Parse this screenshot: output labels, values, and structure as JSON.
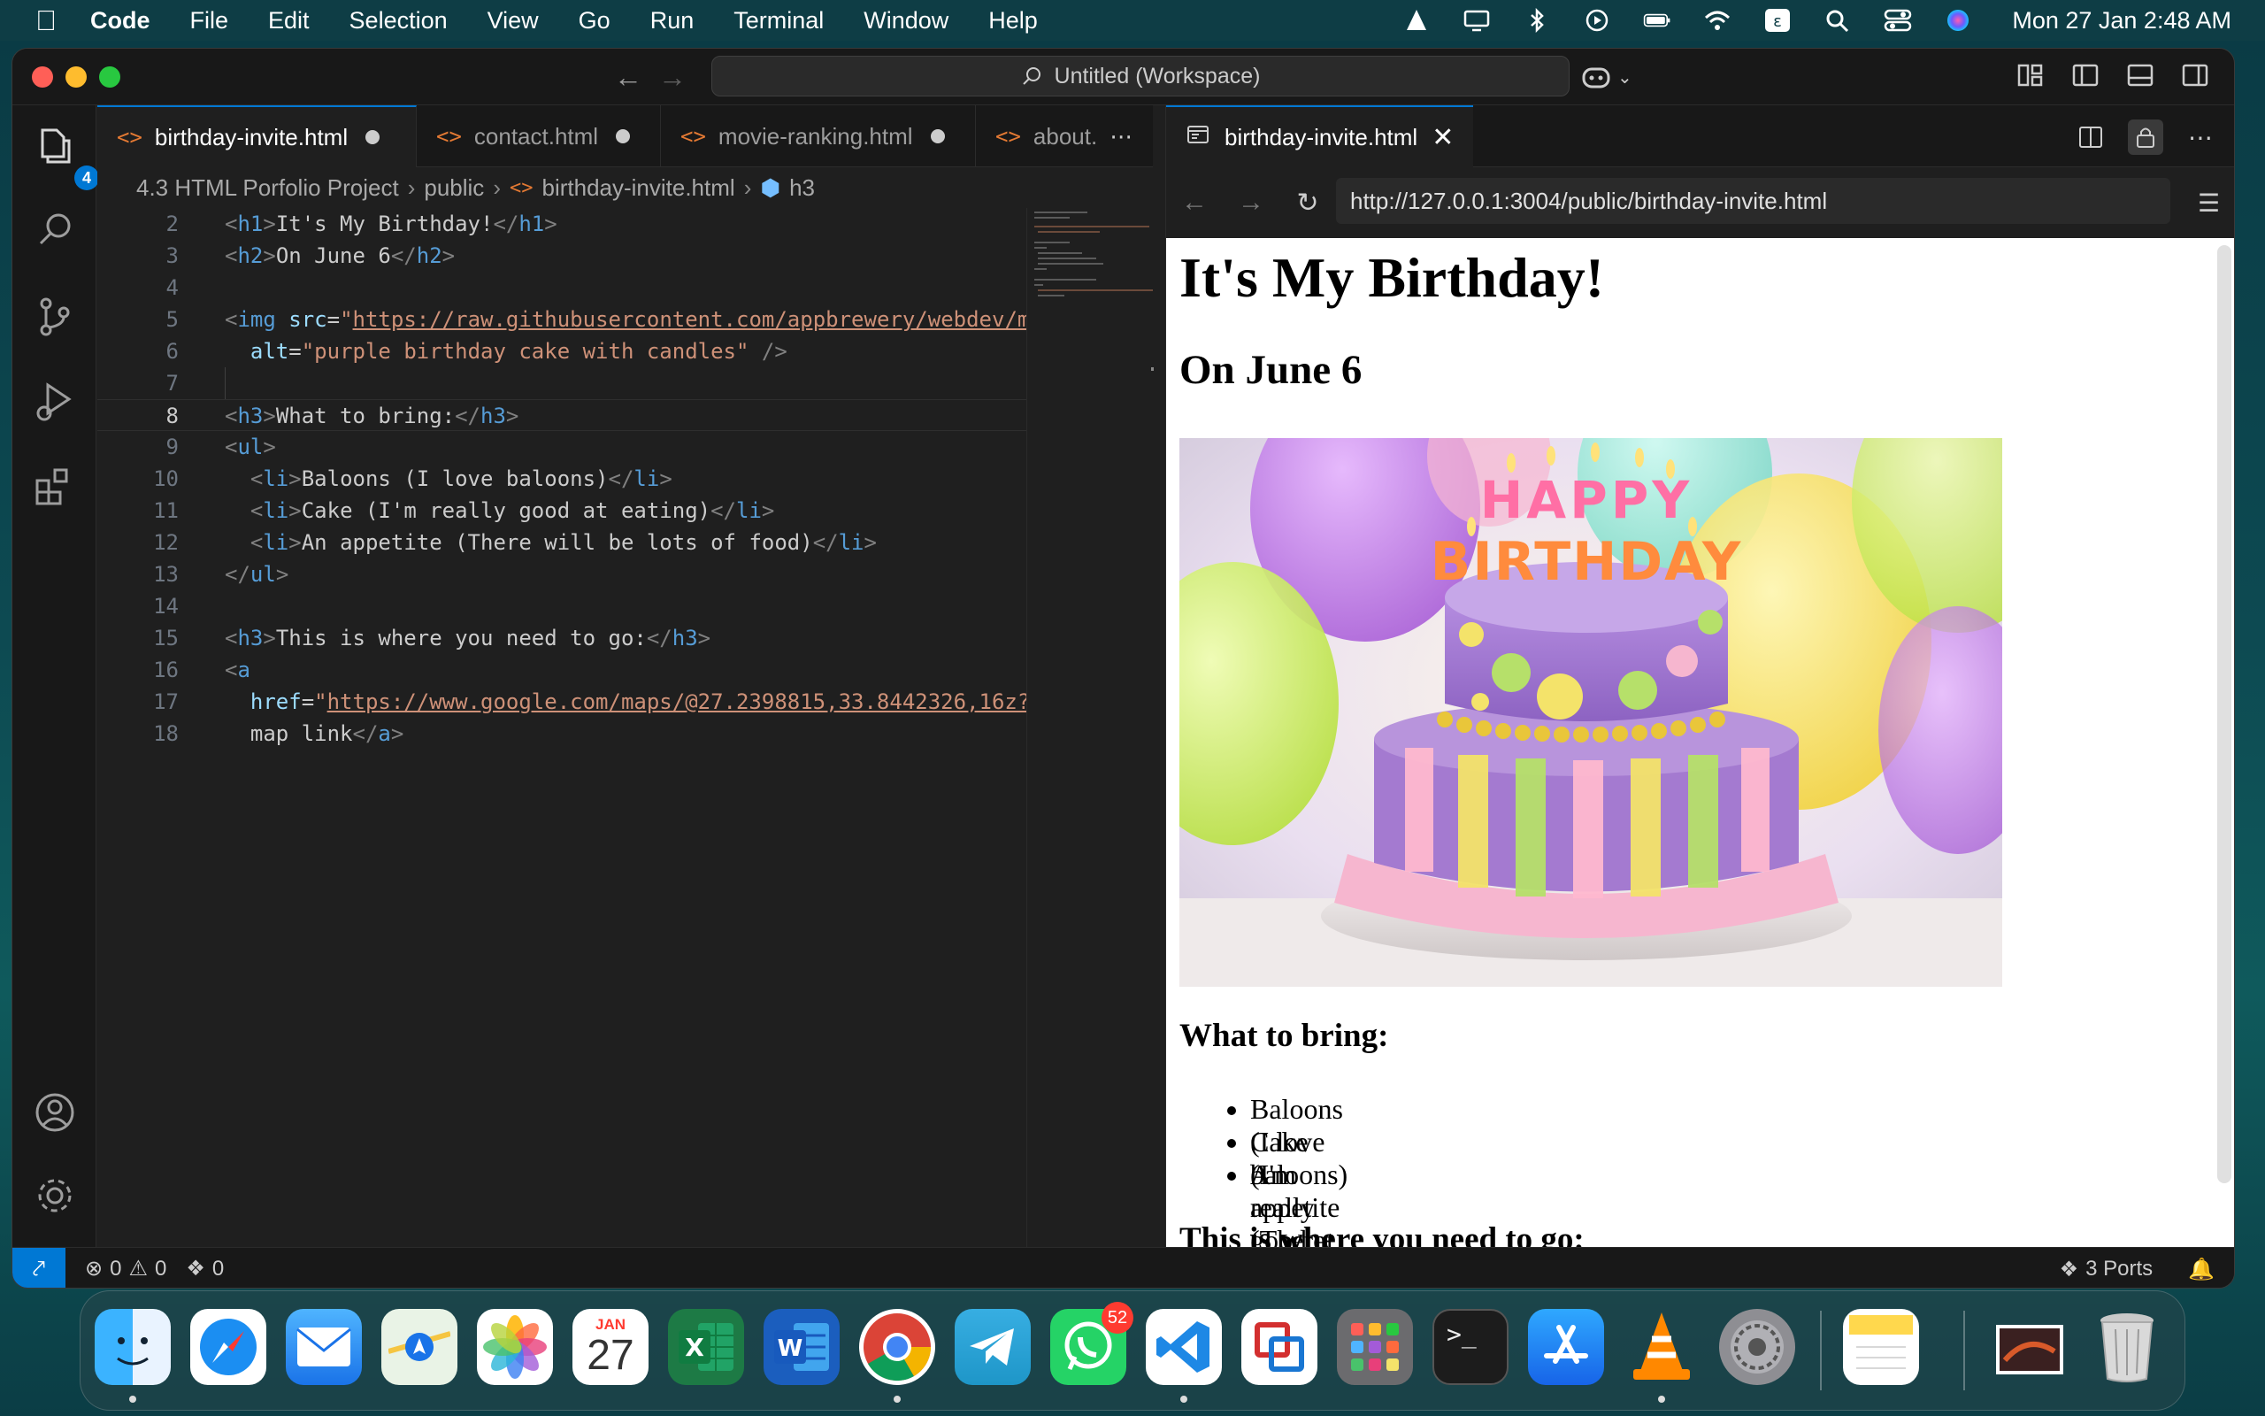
{
  "menubar": {
    "app": "Code",
    "items": [
      "File",
      "Edit",
      "Selection",
      "View",
      "Go",
      "Run",
      "Terminal",
      "Window",
      "Help"
    ],
    "clock": "Mon 27 Jan  2:48 AM"
  },
  "window": {
    "search_title": "Untitled (Workspace)"
  },
  "activity": {
    "explorer_badge": "4"
  },
  "editor": {
    "tabs": [
      {
        "label": "birthday-invite.html"
      },
      {
        "label": "contact.html"
      },
      {
        "label": "movie-ranking.html"
      },
      {
        "label": "about."
      }
    ],
    "breadcrumb": [
      "4.3 HTML Porfolio Project",
      "public",
      "birthday-invite.html",
      "h3"
    ],
    "lines": [
      {
        "n": "2"
      },
      {
        "n": "3"
      },
      {
        "n": "4"
      },
      {
        "n": "5"
      },
      {
        "n": "6"
      },
      {
        "n": "7"
      },
      {
        "n": "8"
      },
      {
        "n": "9"
      },
      {
        "n": "10"
      },
      {
        "n": "11"
      },
      {
        "n": "12"
      },
      {
        "n": "13"
      },
      {
        "n": "14"
      },
      {
        "n": "15"
      },
      {
        "n": "16"
      },
      {
        "n": "17"
      },
      {
        "n": "18"
      }
    ],
    "code": {
      "l2_text": "It's My Birthday!",
      "l3_text": "On June 6",
      "l5_url": "https://raw.githubusercontent.com/appbrewery/webdev/m",
      "l6_alt": "purple birthday cake with candles",
      "l8_text": "What to bring:",
      "l10_text": "Baloons (I love baloons)",
      "l11_text": "Cake (I'm really good at eating)",
      "l12_text": "An appetite (There will be lots of food)",
      "l15_text": "This is where you need to go:",
      "l17_url": "https://www.google.com/maps/@27.2398815,33.8442326,16z?",
      "l18_text": "map link"
    }
  },
  "browser": {
    "tab_label": "birthday-invite.html",
    "url": "http://127.0.0.1:3004/public/birthday-invite.html",
    "page": {
      "h1": "It's My Birthday!",
      "h2": "On June 6",
      "h3_bring": "What to bring:",
      "items": [
        "Baloons (I love baloons)",
        "Cake (I'm really good at eating)",
        "An appetite (There will be lots of food)"
      ],
      "h3_go": "This is where you need to go:",
      "cake_candle_text_1": "HAPPY",
      "cake_candle_text_2": "BIRTHDAY"
    }
  },
  "statusbar": {
    "errors": "0",
    "warnings": "0",
    "broadcast": "0",
    "ports": "3 Ports"
  },
  "dock": {
    "calendar_month": "JAN",
    "calendar_day": "27",
    "whatsapp_badge": "52"
  }
}
